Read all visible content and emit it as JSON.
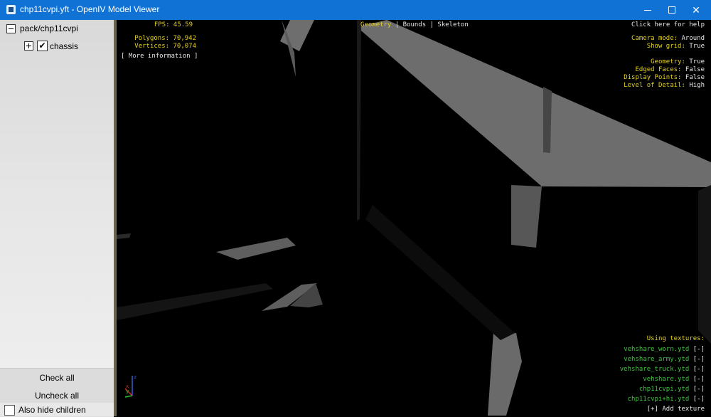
{
  "window": {
    "title": "chp11cvpi.yft - OpenIV Model Viewer",
    "min_icon": "minimize-icon",
    "max_icon": "maximize-icon",
    "close_icon": "close-icon",
    "close_glyph": "✕"
  },
  "tree": {
    "root_label": "pack/chp11cvpi",
    "child_label": "chassis",
    "child_checked": true,
    "check_glyph": "✔"
  },
  "sidebar_buttons": {
    "check_all": "Check all",
    "uncheck_all": "Uncheck all"
  },
  "also_hide_children": {
    "label": "Also hide children",
    "checked": false
  },
  "stats": {
    "fps": "FPS: 45.59",
    "polygons": "Polygons: 70,942",
    "vertices": "Vertices: 70,074",
    "more_info": "[ More information ]"
  },
  "view_tabs": {
    "geometry": "Geometry",
    "sep1": "|",
    "bounds": "Bounds",
    "sep2": "|",
    "skeleton": "Skeleton"
  },
  "help": "Click here for help",
  "settings": {
    "camera_mode_label": "Camera mode:",
    "camera_mode_value": "Around",
    "show_grid_label": "Show grid:",
    "show_grid_value": "True",
    "geometry_label": "Geometry:",
    "geometry_value": "True",
    "edged_faces_label": "Edged Faces:",
    "edged_faces_value": "False",
    "display_points_label": "Display Points:",
    "display_points_value": "False",
    "lod_label": "Level of Detail:",
    "lod_value": "High"
  },
  "textures": {
    "heading": "Using textures:",
    "items": [
      {
        "name": "vehshare_worn.ytd",
        "action": "[-]"
      },
      {
        "name": "vehshare_army.ytd",
        "action": "[-]"
      },
      {
        "name": "vehshare_truck.ytd",
        "action": "[-]"
      },
      {
        "name": "vehshare.ytd",
        "action": "[-]"
      },
      {
        "name": "chp11cvpi.ytd",
        "action": "[-]"
      },
      {
        "name": "chp11cvpi+hi.ytd",
        "action": "[-]"
      }
    ],
    "add": "[+] Add texture"
  },
  "colors": {
    "titlebar": "#1172d6",
    "stat_yellow": "#e6d21e",
    "texture_green": "#3ec83e",
    "viewport_bg": "#000000"
  }
}
